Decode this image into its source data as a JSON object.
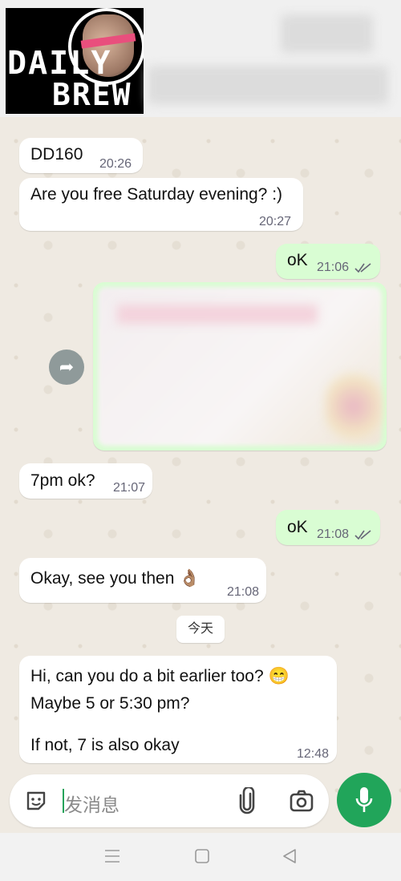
{
  "header": {
    "logo_text_top": "DAILY",
    "logo_text_bottom": "BREW"
  },
  "messages": [
    {
      "dir": "in",
      "text": "DD160",
      "time": "20:26"
    },
    {
      "dir": "in",
      "text": "Are you free Saturday evening? :)",
      "time": "20:27"
    },
    {
      "dir": "out",
      "text": "oK",
      "time": "21:06"
    },
    {
      "dir": "in",
      "text": "7pm ok?",
      "time": "21:07"
    },
    {
      "dir": "out",
      "text": "oK",
      "time": "21:08"
    },
    {
      "dir": "in",
      "text": "Okay, see you then 👌🏽",
      "time": "21:08"
    },
    {
      "dir": "in",
      "lines": [
        "Hi, can you do a bit earlier too? 😁",
        "Maybe 5 or 5:30 pm?",
        "If not, 7 is also okay"
      ],
      "time": "12:48"
    }
  ],
  "day_separator": "今天",
  "composer": {
    "placeholder": "发消息",
    "icons": [
      "sticker-icon",
      "attach-icon",
      "camera-icon",
      "mic-icon"
    ]
  },
  "colors": {
    "outgoing_bubble": "#d9fdd3",
    "incoming_bubble": "#ffffff",
    "accent_green": "#21a55a"
  }
}
